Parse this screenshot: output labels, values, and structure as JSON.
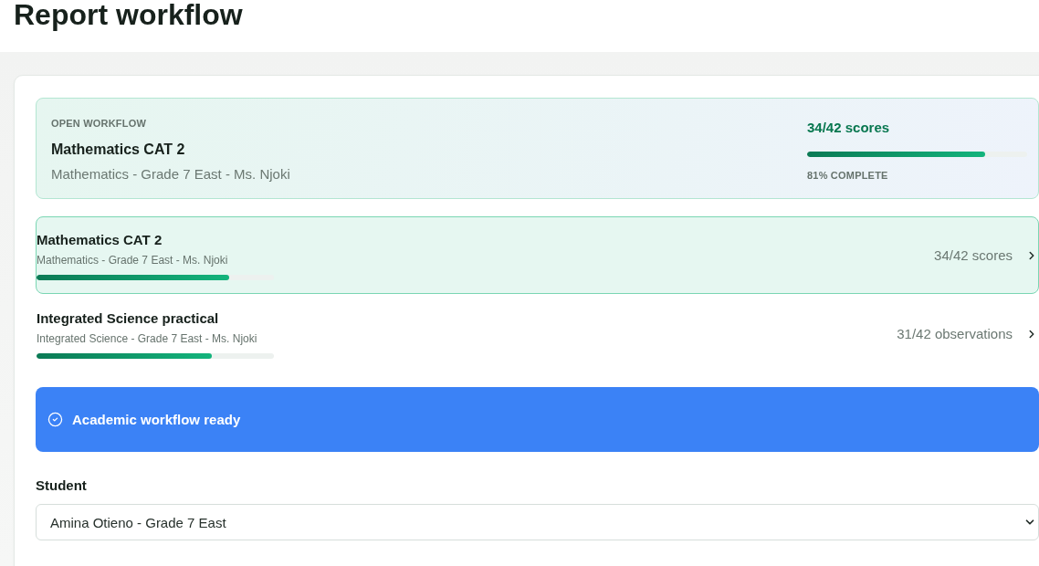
{
  "page": {
    "title": "Report workflow"
  },
  "open_workflow": {
    "label": "OPEN WORKFLOW",
    "title": "Mathematics CAT 2",
    "subtitle": "Mathematics - Grade 7 East - Ms. Njoki",
    "count": "34/42 scores",
    "level": 0.81,
    "progress_label": "81% COMPLETE"
  },
  "workflows": [
    {
      "title": "Mathematics CAT 2",
      "subtitle": "Mathematics - Grade 7 East - Ms. Njoki",
      "count": "34/42 scores",
      "level": 0.81,
      "selected": true
    },
    {
      "title": "Integrated Science practical",
      "subtitle": "Integrated Science - Grade 7 East - Ms. Njoki",
      "count": "31/42 observations",
      "level": 0.74,
      "selected": false
    }
  ],
  "banner": {
    "text": "Academic workflow ready"
  },
  "student_field": {
    "label": "Student",
    "value": "Amina Otieno - Grade 7 East"
  }
}
